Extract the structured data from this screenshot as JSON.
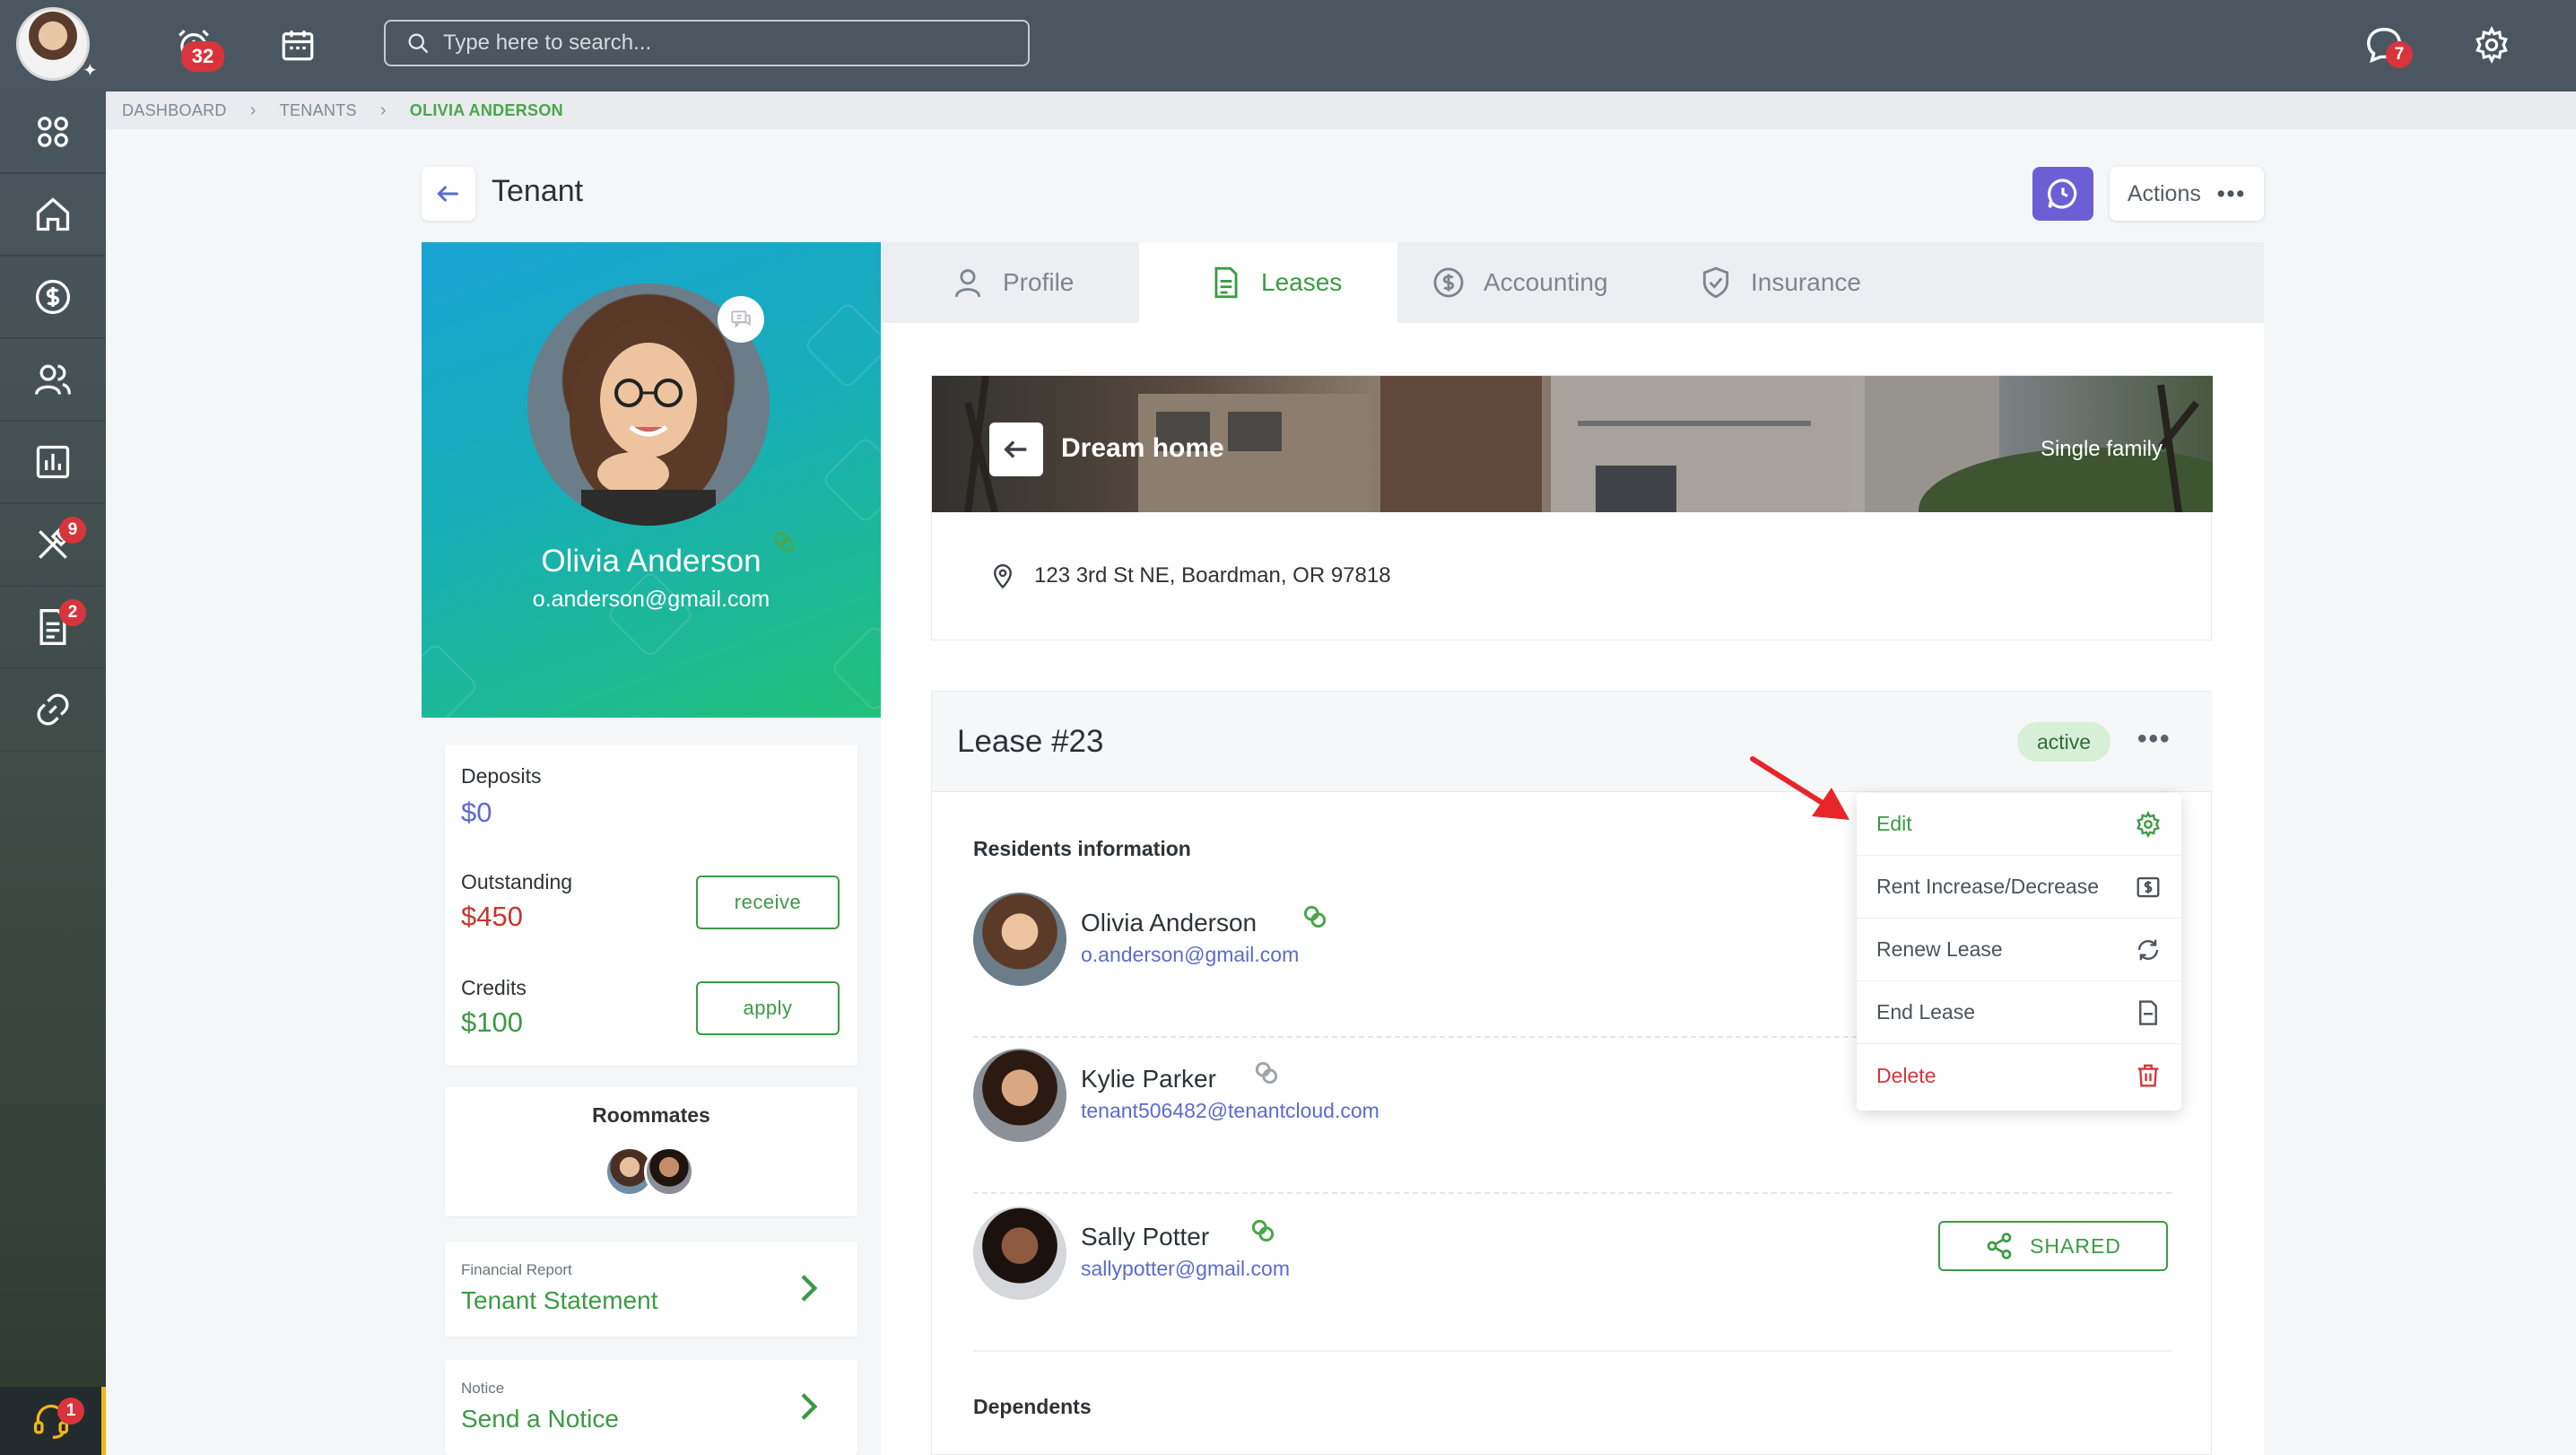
{
  "topbar": {
    "alarm_badge": "32",
    "search_placeholder": "Type here to search...",
    "messages_badge": "7"
  },
  "sidebar": {
    "items": [
      {
        "name": "apps",
        "icon": "grid-icon"
      },
      {
        "name": "home",
        "icon": "home-icon"
      },
      {
        "name": "payments",
        "icon": "dollar-circle-icon"
      },
      {
        "name": "contacts",
        "icon": "users-icon"
      },
      {
        "name": "reports",
        "icon": "chart-icon"
      },
      {
        "name": "maintenance",
        "icon": "tools-icon",
        "badge": "9"
      },
      {
        "name": "documents",
        "icon": "document-icon",
        "badge": "2"
      },
      {
        "name": "links",
        "icon": "link-icon"
      }
    ],
    "support_badge": "1"
  },
  "breadcrumb": {
    "items": [
      "DASHBOARD",
      "TENANTS"
    ],
    "current": "OLIVIA ANDERSON"
  },
  "header": {
    "title": "Tenant",
    "actions_label": "Actions"
  },
  "profile": {
    "name": "Olivia Anderson",
    "email": "o.anderson@gmail.com"
  },
  "balances": {
    "deposits_label": "Deposits",
    "deposits_value": "$0",
    "outstanding_label": "Outstanding",
    "outstanding_value": "$450",
    "receive_label": "receive",
    "credits_label": "Credits",
    "credits_value": "$100",
    "apply_label": "apply"
  },
  "roommates": {
    "title": "Roommates"
  },
  "financial_report": {
    "small": "Financial Report",
    "link": "Tenant Statement"
  },
  "notice": {
    "small": "Notice",
    "link": "Send a Notice"
  },
  "tabs": [
    {
      "label": "Profile",
      "icon": "user-icon"
    },
    {
      "label": "Leases",
      "icon": "document-icon",
      "active": true
    },
    {
      "label": "Accounting",
      "icon": "dollar-circle-icon"
    },
    {
      "label": "Insurance",
      "icon": "shield-check-icon"
    }
  ],
  "property": {
    "name": "Dream home",
    "type": "Single family",
    "address": "123 3rd St NE, Boardman, OR 97818"
  },
  "lease": {
    "title": "Lease #23",
    "status": "active",
    "residents_label": "Residents information",
    "residents": [
      {
        "name": "Olivia Anderson",
        "email": "o.anderson@gmail.com",
        "linked": true
      },
      {
        "name": "Kylie Parker",
        "email": "tenant506482@tenantcloud.com",
        "linked": false
      },
      {
        "name": "Sally Potter",
        "email": "sallypotter@gmail.com",
        "linked": true
      }
    ],
    "shared_label": "SHARED",
    "dependents_label": "Dependents"
  },
  "menu": {
    "items": [
      {
        "label": "Edit",
        "icon": "gear-icon"
      },
      {
        "label": "Rent Increase/Decrease",
        "icon": "dollar-square-icon"
      },
      {
        "label": "Renew Lease",
        "icon": "refresh-icon"
      },
      {
        "label": "End Lease",
        "icon": "file-icon"
      },
      {
        "label": "Delete",
        "icon": "trash-icon"
      }
    ]
  },
  "colors": {
    "accent_green": "#3c9a44",
    "danger_red": "#d7353b",
    "link_blue": "#5a6bd0",
    "topbar": "#4a5761",
    "chat_purple": "#6c5fd6"
  }
}
